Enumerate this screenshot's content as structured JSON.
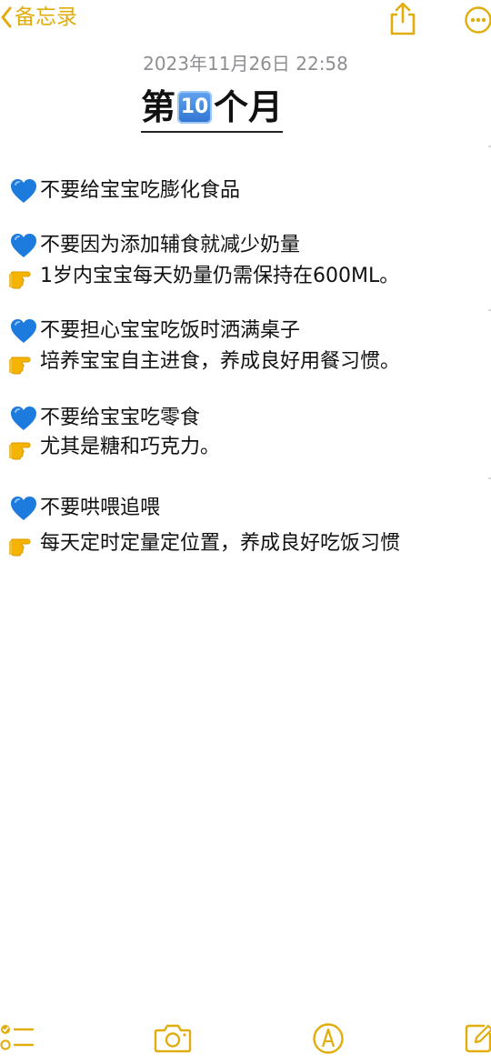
{
  "nav": {
    "back_label": "备忘录"
  },
  "note": {
    "date": "2023年11月26日 22:58",
    "title_prefix": "第",
    "title_number": "10",
    "title_suffix": "个月",
    "lines": [
      {
        "icon": "blue-heart",
        "text": "不要给宝宝吃膨化食品"
      },
      {
        "icon": "blue-heart",
        "text": "不要因为添加辅食就减少奶量"
      },
      {
        "icon": "pointing-hand",
        "text": "1岁内宝宝每天奶量仍需保持在600ML。"
      },
      {
        "icon": "blue-heart",
        "text": "不要担心宝宝吃饭时洒满桌子"
      },
      {
        "icon": "pointing-hand",
        "text": "培养宝宝自主进食，养成良好用餐习惯。"
      },
      {
        "icon": "blue-heart",
        "text": "不要给宝宝吃零食"
      },
      {
        "icon": "pointing-hand",
        "text": "尤其是糖和巧克力。"
      },
      {
        "icon": "blue-heart",
        "text": " 不要哄喂追喂"
      },
      {
        "icon": "pointing-hand",
        "text": "每天定时定量定位置，养成良好吃饭习惯"
      }
    ]
  },
  "colors": {
    "accent": "#e1ad0c",
    "heart": "#1c7bdc",
    "hand": "#f4b400"
  },
  "toolbar": {
    "icons": [
      "checklist-icon",
      "camera-icon",
      "markup-icon",
      "compose-icon"
    ]
  }
}
